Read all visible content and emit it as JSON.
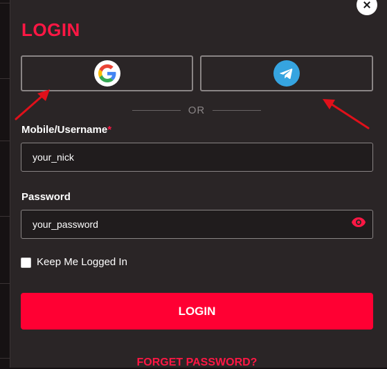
{
  "dialog": {
    "title": "LOGIN",
    "close_icon": "close-icon"
  },
  "social": {
    "google_icon": "google-icon",
    "telegram_icon": "telegram-icon",
    "divider_text": "OR"
  },
  "form": {
    "username_label": "Mobile/Username",
    "required_mark": "*",
    "username_value": "your_nick",
    "password_label": "Password",
    "password_value": "your_password",
    "password_toggle_icon": "eye-icon",
    "remember_label": "Keep Me Logged In",
    "remember_checked": false,
    "login_label": "LOGIN",
    "forgot_label": "FORGET PASSWORD?"
  },
  "annotations": {
    "arrow_color": "#e0101a"
  },
  "colors": {
    "accent": "#ff0033",
    "title": "#ff1744",
    "background": "#2a2526",
    "telegram": "#36a4e0"
  }
}
